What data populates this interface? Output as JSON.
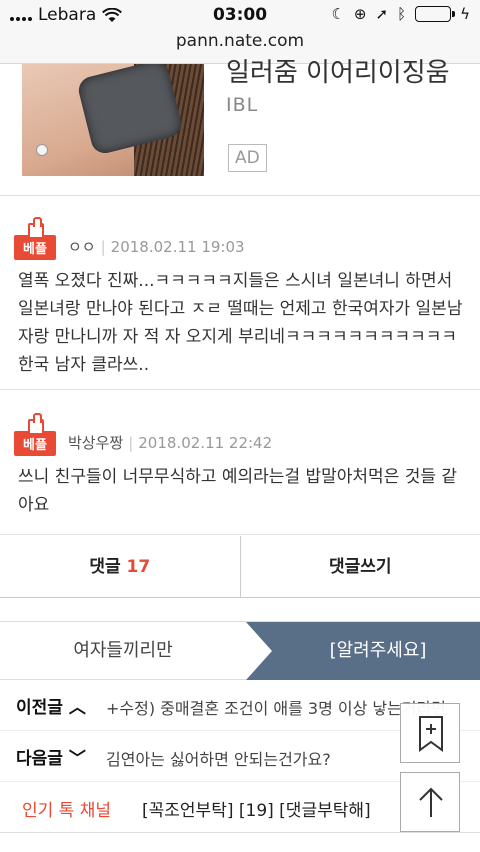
{
  "status_bar": {
    "carrier": "Lebara",
    "time": "03:00",
    "url": "pann.nate.com",
    "icons": [
      "signal-icon",
      "wifi-icon",
      "moon-icon",
      "rotation-lock-icon",
      "location-icon",
      "bluetooth-icon",
      "battery-icon",
      "charging-icon"
    ],
    "battery_color": "#4cd964"
  },
  "ad": {
    "title": "일러줌 이어리이징움",
    "brand": "IBL",
    "badge": "AD"
  },
  "comments": [
    {
      "badge": "베플",
      "nickname": "ㅇㅇ",
      "date": "2018.02.11 19:03",
      "text": "열폭 오졌다 진짜...ㅋㅋㅋㅋㅋ지들은 스시녀 일본녀니 하면서 일본녀랑 만나야 된다고 ㅈㄹ 떨때는 언제고 한국여자가 일본남자랑 만나니까 자 적 자 오지게 부리네ㅋㅋㅋㅋㅋㅋㅋㅋㅋㅋㅋ한국 남자 클라쓰.."
    },
    {
      "badge": "베플",
      "nickname": "박상우짱",
      "date": "2018.02.11 22:42",
      "text": "쓰니 친구들이 너무무식하고 예의라는걸 밥말아처먹은 것들 같아요"
    }
  ],
  "actions": {
    "comments_label": "댓글",
    "comments_count": "17",
    "write_label": "댓글쓰기"
  },
  "channel_tabs": {
    "left": "여자들끼리만",
    "right": "[알려주세요]"
  },
  "nav": {
    "prev_label": "이전글",
    "prev_title": "+수정) 중매결혼 조건이 애를 3명 이상 낳는거라면",
    "next_label": "다음글",
    "next_title": "김연아는 싫어하면 안되는건가요?"
  },
  "popular": {
    "label": "인기 톡 채널",
    "items": "[꼭조언부탁] [19] [댓글부탁해]"
  },
  "colors": {
    "accent_red": "#e94a35",
    "tab_active": "#596e87"
  }
}
